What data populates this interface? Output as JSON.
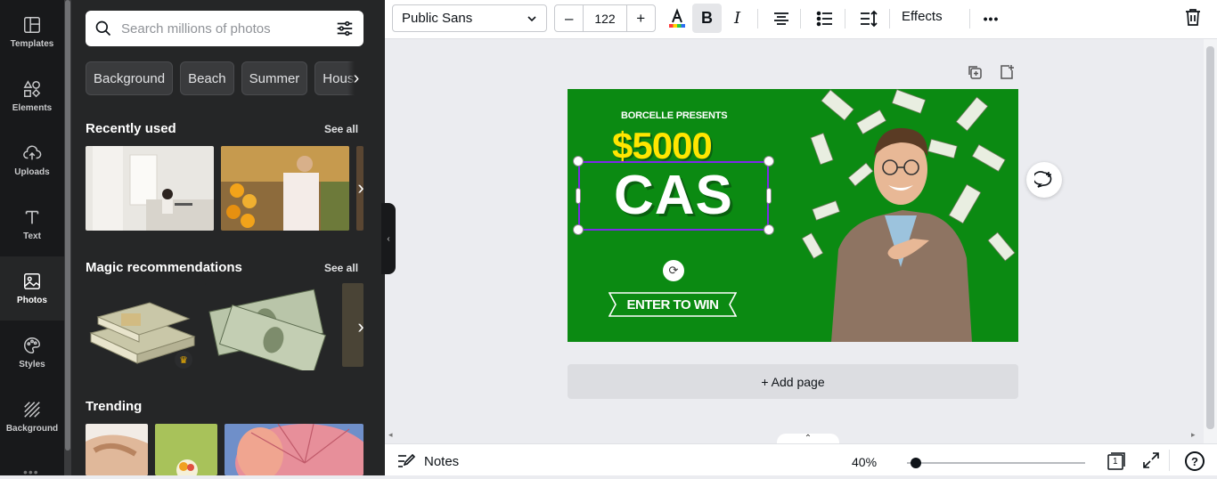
{
  "rail": {
    "items": [
      {
        "label": "Templates",
        "icon": "templates-icon"
      },
      {
        "label": "Elements",
        "icon": "elements-icon"
      },
      {
        "label": "Uploads",
        "icon": "uploads-icon"
      },
      {
        "label": "Text",
        "icon": "text-icon"
      },
      {
        "label": "Photos",
        "icon": "photos-icon",
        "active": true
      },
      {
        "label": "Styles",
        "icon": "styles-icon"
      },
      {
        "label": "Background",
        "icon": "background-icon"
      }
    ],
    "more": "•••"
  },
  "panel": {
    "search_placeholder": "Search millions of photos",
    "chips": [
      "Background",
      "Beach",
      "Summer",
      "House"
    ],
    "recently_used": {
      "title": "Recently used",
      "see_all": "See all"
    },
    "magic": {
      "title": "Magic recommendations",
      "see_all": "See all"
    },
    "trending": {
      "title": "Trending"
    }
  },
  "toolbar": {
    "font": "Public Sans",
    "font_size": "122",
    "minus": "–",
    "plus": "+",
    "bold": "B",
    "italic": "I",
    "effects": "Effects",
    "more": "•••"
  },
  "design": {
    "presents": "BORCELLE PRESENTS",
    "amount": "$5000",
    "headline": "CAS",
    "cta": "ENTER TO WIN"
  },
  "canvas": {
    "add_page": "+ Add page"
  },
  "bottombar": {
    "notes": "Notes",
    "zoom": "40%",
    "page_count": "1",
    "help": "?"
  },
  "colors": {
    "design_bg": "#0b8a12",
    "amount": "#ffe600",
    "selection": "#7d2ae8",
    "rail_bg": "#18191b",
    "panel_bg": "#252627"
  }
}
